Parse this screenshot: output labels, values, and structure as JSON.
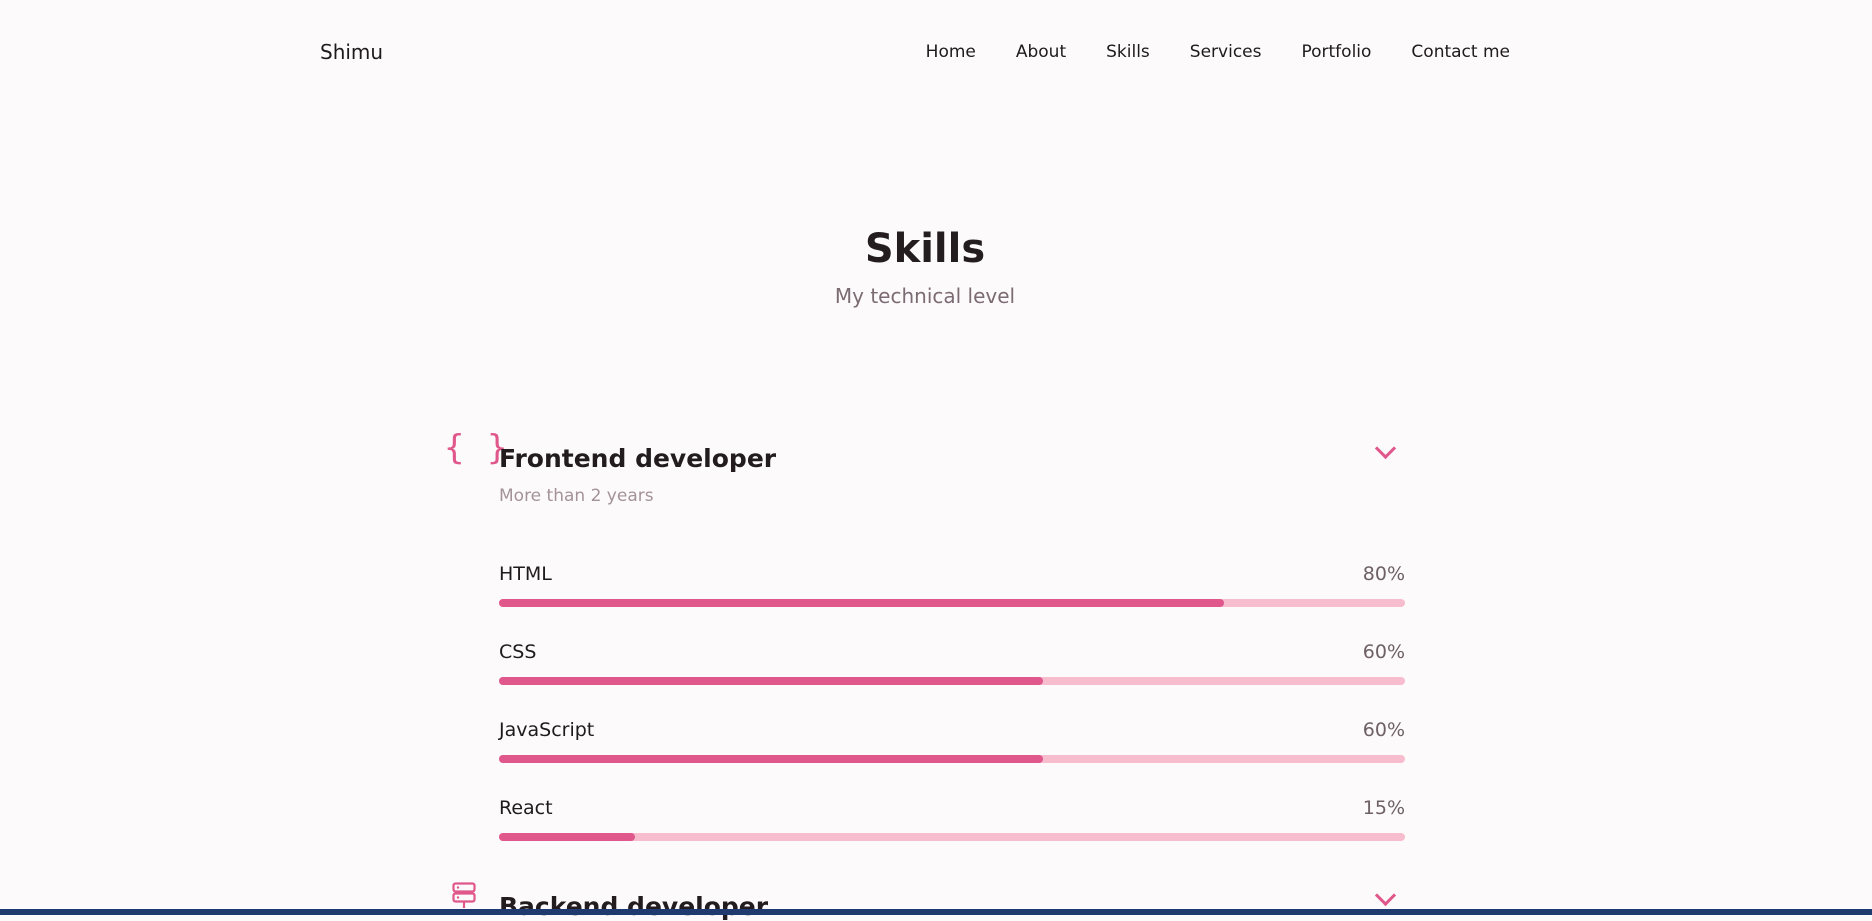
{
  "header": {
    "logo": "Shimu",
    "nav": [
      "Home",
      "About",
      "Skills",
      "Services",
      "Portfolio",
      "Contact me"
    ]
  },
  "section": {
    "title": "Skills",
    "subtitle": "My technical level"
  },
  "frontend": {
    "icon": "code-braces-icon",
    "icon_glyph": "{ }",
    "title": "Frontend developer",
    "subtitle": "More than 2 years",
    "skills": [
      {
        "name": "HTML",
        "percent": "80%",
        "level": 0.8
      },
      {
        "name": "CSS",
        "percent": "60%",
        "level": 0.6
      },
      {
        "name": "JavaScript",
        "percent": "60%",
        "level": 0.6
      },
      {
        "name": "React",
        "percent": "15%",
        "level": 0.15
      }
    ]
  },
  "backend": {
    "icon": "server-icon",
    "title": "Backend developer"
  },
  "colors": {
    "accent": "#e0578b",
    "bar_track": "#f8bccf",
    "background": "#fdfafb",
    "bottom_strip": "#1e3a6e"
  }
}
